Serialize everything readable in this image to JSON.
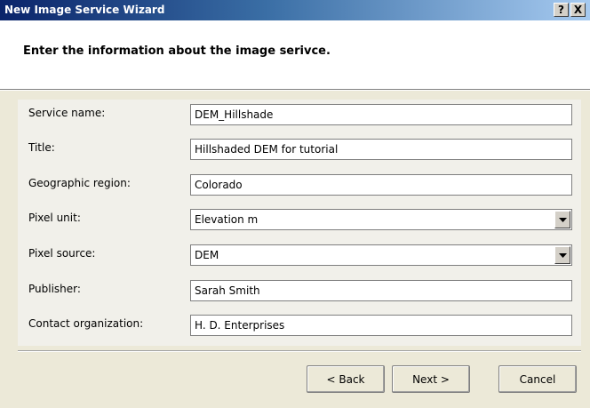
{
  "window": {
    "title": "New Image Service Wizard",
    "help_glyph": "?",
    "close_glyph": "X"
  },
  "header": {
    "heading": "Enter the information about the image serivce."
  },
  "form": {
    "service_name": {
      "label": "Service name:",
      "value": "DEM_Hillshade"
    },
    "title": {
      "label": "Title:",
      "value": "Hillshaded DEM for tutorial"
    },
    "geographic_region": {
      "label": "Geographic region:",
      "value": "Colorado"
    },
    "pixel_unit": {
      "label": "Pixel unit:",
      "value": "Elevation m"
    },
    "pixel_source": {
      "label": "Pixel source:",
      "value": "DEM"
    },
    "publisher": {
      "label": "Publisher:",
      "value": "Sarah Smith"
    },
    "contact_organization": {
      "label": "Contact organization:",
      "value": "H. D. Enterprises"
    }
  },
  "buttons": {
    "back": "< Back",
    "next": "Next >",
    "cancel": "Cancel"
  },
  "colors": {
    "titlebar_start": "#0a246a",
    "titlebar_end": "#a6caf0",
    "dialog_background": "#ece9d8"
  },
  "icons": {
    "help": "help-icon",
    "close": "close-icon",
    "dropdown": "chevron-down-icon"
  }
}
